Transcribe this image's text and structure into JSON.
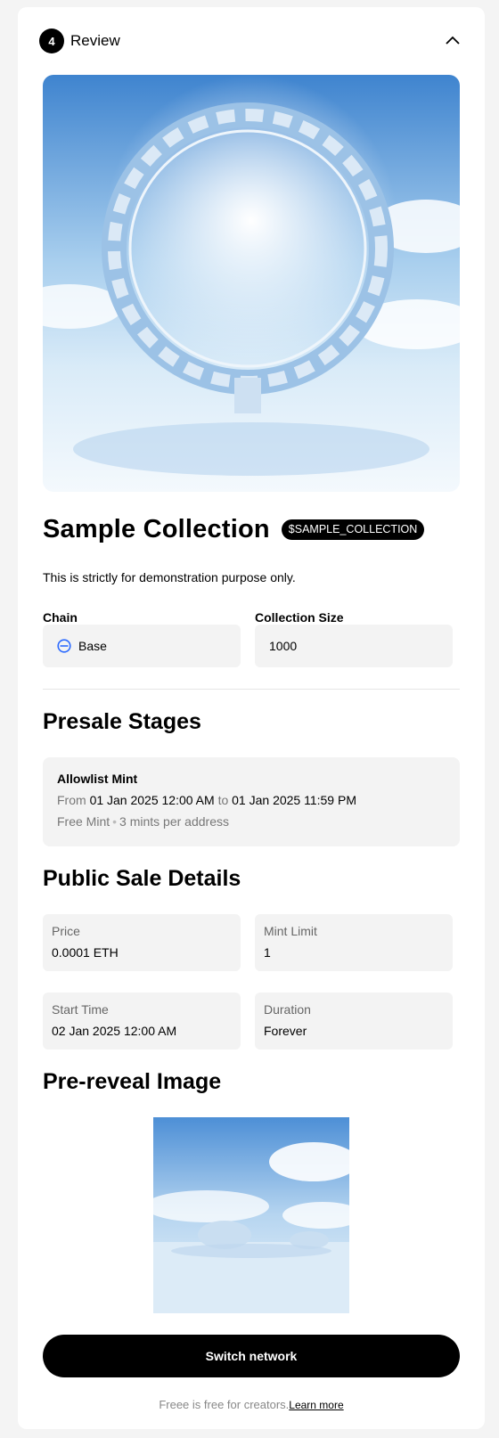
{
  "step": {
    "number": "4",
    "title": "Review"
  },
  "collection": {
    "name": "Sample Collection",
    "symbol": "$SAMPLE_COLLECTION",
    "description": "This is strictly for demonstration purpose only."
  },
  "chain": {
    "label": "Chain",
    "value": "Base",
    "icon": "base-chain-icon",
    "icon_color": "#2d6bff"
  },
  "collection_size": {
    "label": "Collection Size",
    "value": "1000"
  },
  "presale": {
    "title": "Presale Stages",
    "stages": [
      {
        "name": "Allowlist Mint",
        "from_label": "From",
        "from": "01 Jan 2025 12:00 AM",
        "to_label": "to",
        "to": "01 Jan 2025 11:59 PM",
        "price_type": "Free Mint",
        "limit": "3 mints per address"
      }
    ]
  },
  "public_sale": {
    "title": "Public Sale Details",
    "price": {
      "label": "Price",
      "value": "0.0001 ETH"
    },
    "mint_limit": {
      "label": "Mint Limit",
      "value": "1"
    },
    "start_time": {
      "label": "Start Time",
      "value": "02 Jan 2025 12:00 AM"
    },
    "duration": {
      "label": "Duration",
      "value": "Forever"
    }
  },
  "prereveal": {
    "title": "Pre-reveal Image"
  },
  "actions": {
    "switch_network": "Switch network"
  },
  "footer": {
    "text": "Freee is free for creators.",
    "link": "Learn more"
  }
}
